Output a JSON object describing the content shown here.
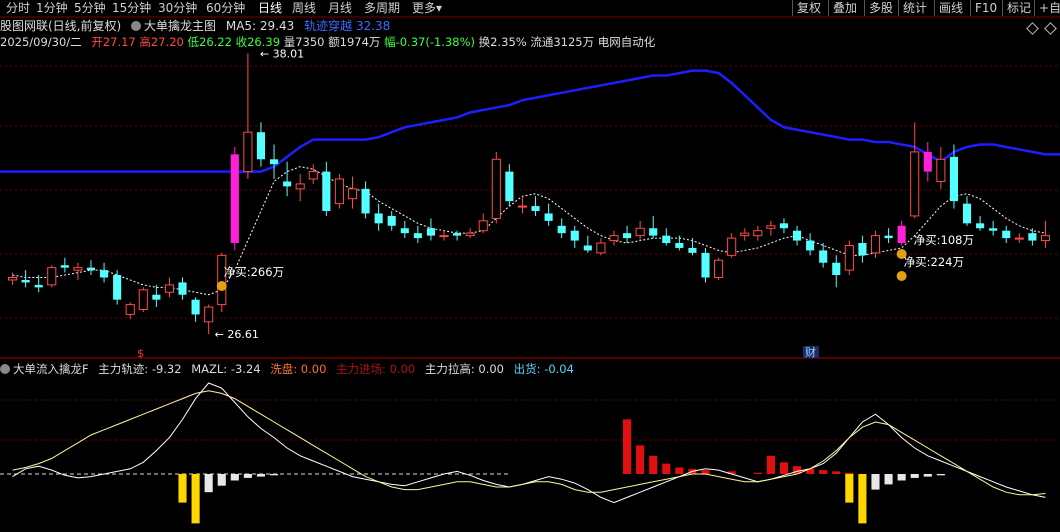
{
  "toolbar": {
    "periods": [
      "分时",
      "1分钟",
      "5分钟",
      "15分钟",
      "30分钟",
      "60分钟",
      "日线",
      "周线",
      "月线",
      "多周期",
      "更多"
    ],
    "active_period": "日线",
    "more_suffix": "▾",
    "right_buttons": [
      "复权",
      "叠加",
      "多股",
      "统计",
      "画线",
      "F10",
      "标记",
      "+自"
    ]
  },
  "header": {
    "stock_name": "股图网联(日线,前复权)",
    "indicator_name": "大单擒龙主图",
    "ma5_label": "MA5: 29.43",
    "ma_extra": "轨迹穿越",
    "ma_extra_value": "32.38"
  },
  "quote": {
    "date": "2025/09/30/二",
    "open_label": "开",
    "open": "27.17",
    "high_label": "高",
    "high": "27.20",
    "low_label": "低",
    "low": "26.22",
    "close_label": "收",
    "close": "26.39",
    "volume_label": "量",
    "volume": "7350",
    "amount_label": "额",
    "amount": "1974万",
    "change_label": "幅",
    "change": "-0.37(-1.38%)",
    "turnover_label": "换",
    "turnover": "2.35%",
    "float_label": "流通",
    "float": "3125万",
    "sector": "电网自动化"
  },
  "annotations": {
    "high_price": "38.01",
    "low_price": "26.61",
    "net_buy_1": "净买:266万",
    "net_buy_2": "净买:108万",
    "net_buy_3": "净买:224万",
    "finance_marker": "财",
    "dollar_marker": "$"
  },
  "indicator": {
    "name": "大单流入擒龙F",
    "track_label": "主力轨迹:",
    "track_value": "-9.32",
    "mazl_label": "MAZL:",
    "mazl_value": "-3.24",
    "wash_label": "洗盘:",
    "wash_value": "0.00",
    "enter_label": "主力进场:",
    "enter_value": "0.00",
    "lift_label": "主力拉高:",
    "lift_value": "0.00",
    "ship_label": "出货:",
    "ship_value": "-0.04"
  },
  "colors": {
    "up": "#ff4a4a",
    "down": "#54ffff",
    "ma_blue": "#1e1eff",
    "magenta": "#ff20d8",
    "grid": "#6a0000",
    "yellow": "#ffd700",
    "white_line": "#ffffff"
  },
  "chart_data": {
    "type": "candlestick",
    "price_range": [
      26.2,
      38.3
    ],
    "candles": [
      {
        "o": 28.8,
        "h": 29.1,
        "l": 28.6,
        "c": 28.9
      },
      {
        "o": 28.8,
        "h": 29.2,
        "l": 28.5,
        "c": 28.7
      },
      {
        "o": 28.6,
        "h": 29.0,
        "l": 28.3,
        "c": 28.5
      },
      {
        "o": 28.6,
        "h": 29.4,
        "l": 28.5,
        "c": 29.3
      },
      {
        "o": 29.4,
        "h": 29.7,
        "l": 29.1,
        "c": 29.3
      },
      {
        "o": 29.2,
        "h": 29.5,
        "l": 28.8,
        "c": 29.3
      },
      {
        "o": 29.3,
        "h": 29.6,
        "l": 29.0,
        "c": 29.2
      },
      {
        "o": 29.2,
        "h": 29.5,
        "l": 28.7,
        "c": 28.9
      },
      {
        "o": 29.0,
        "h": 29.2,
        "l": 27.8,
        "c": 28.0
      },
      {
        "o": 27.4,
        "h": 27.9,
        "l": 27.2,
        "c": 27.8
      },
      {
        "o": 27.6,
        "h": 28.5,
        "l": 27.5,
        "c": 28.4
      },
      {
        "o": 28.2,
        "h": 28.6,
        "l": 27.7,
        "c": 28.0
      },
      {
        "o": 28.3,
        "h": 28.9,
        "l": 28.1,
        "c": 28.6
      },
      {
        "o": 28.7,
        "h": 28.9,
        "l": 28.0,
        "c": 28.2
      },
      {
        "o": 28.0,
        "h": 28.1,
        "l": 27.1,
        "c": 27.4
      },
      {
        "o": 27.1,
        "h": 27.8,
        "l": 26.6,
        "c": 27.7
      },
      {
        "o": 27.8,
        "h": 29.9,
        "l": 27.5,
        "c": 29.8
      },
      {
        "o": 30.3,
        "h": 34.2,
        "l": 30.0,
        "c": 33.9
      },
      {
        "o": 33.2,
        "h": 38.0,
        "l": 32.9,
        "c": 34.8
      },
      {
        "o": 34.8,
        "h": 35.2,
        "l": 33.4,
        "c": 33.7
      },
      {
        "o": 33.7,
        "h": 34.3,
        "l": 32.9,
        "c": 33.5
      },
      {
        "o": 32.8,
        "h": 33.6,
        "l": 32.2,
        "c": 32.6
      },
      {
        "o": 32.5,
        "h": 33.1,
        "l": 32.0,
        "c": 32.7
      },
      {
        "o": 32.9,
        "h": 33.5,
        "l": 32.7,
        "c": 33.2
      },
      {
        "o": 33.2,
        "h": 33.6,
        "l": 31.4,
        "c": 31.6
      },
      {
        "o": 31.9,
        "h": 33.1,
        "l": 31.7,
        "c": 32.9
      },
      {
        "o": 32.1,
        "h": 33.0,
        "l": 31.7,
        "c": 32.5
      },
      {
        "o": 32.5,
        "h": 32.8,
        "l": 31.3,
        "c": 31.5
      },
      {
        "o": 31.5,
        "h": 31.9,
        "l": 30.8,
        "c": 31.1
      },
      {
        "o": 31.4,
        "h": 31.6,
        "l": 30.8,
        "c": 31.0
      },
      {
        "o": 30.9,
        "h": 31.2,
        "l": 30.5,
        "c": 30.7
      },
      {
        "o": 30.7,
        "h": 31.0,
        "l": 30.3,
        "c": 30.5
      },
      {
        "o": 30.9,
        "h": 31.3,
        "l": 30.4,
        "c": 30.6
      },
      {
        "o": 30.6,
        "h": 30.8,
        "l": 30.4,
        "c": 30.6
      },
      {
        "o": 30.7,
        "h": 30.8,
        "l": 30.4,
        "c": 30.6
      },
      {
        "o": 30.6,
        "h": 30.9,
        "l": 30.5,
        "c": 30.7
      },
      {
        "o": 30.8,
        "h": 31.5,
        "l": 30.7,
        "c": 31.2
      },
      {
        "o": 31.3,
        "h": 34.0,
        "l": 31.1,
        "c": 33.7
      },
      {
        "o": 33.2,
        "h": 33.5,
        "l": 31.8,
        "c": 32.0
      },
      {
        "o": 31.8,
        "h": 32.2,
        "l": 31.5,
        "c": 31.8
      },
      {
        "o": 31.8,
        "h": 32.2,
        "l": 31.4,
        "c": 31.6
      },
      {
        "o": 31.5,
        "h": 31.9,
        "l": 31.0,
        "c": 31.2
      },
      {
        "o": 31.0,
        "h": 31.3,
        "l": 30.5,
        "c": 30.7
      },
      {
        "o": 30.8,
        "h": 31.0,
        "l": 30.1,
        "c": 30.4
      },
      {
        "o": 30.2,
        "h": 30.6,
        "l": 29.9,
        "c": 30.0
      },
      {
        "o": 29.9,
        "h": 30.5,
        "l": 29.8,
        "c": 30.3
      },
      {
        "o": 30.4,
        "h": 30.8,
        "l": 30.2,
        "c": 30.6
      },
      {
        "o": 30.7,
        "h": 31.0,
        "l": 30.3,
        "c": 30.5
      },
      {
        "o": 30.6,
        "h": 31.2,
        "l": 30.4,
        "c": 30.9
      },
      {
        "o": 30.9,
        "h": 31.4,
        "l": 30.5,
        "c": 30.6
      },
      {
        "o": 30.6,
        "h": 30.9,
        "l": 30.2,
        "c": 30.3
      },
      {
        "o": 30.3,
        "h": 30.6,
        "l": 30.0,
        "c": 30.1
      },
      {
        "o": 30.1,
        "h": 30.5,
        "l": 29.8,
        "c": 29.9
      },
      {
        "o": 29.9,
        "h": 30.1,
        "l": 28.7,
        "c": 28.9
      },
      {
        "o": 28.9,
        "h": 29.7,
        "l": 28.8,
        "c": 29.6
      },
      {
        "o": 29.8,
        "h": 30.7,
        "l": 29.7,
        "c": 30.5
      },
      {
        "o": 30.6,
        "h": 30.9,
        "l": 30.4,
        "c": 30.7
      },
      {
        "o": 30.6,
        "h": 31.0,
        "l": 30.4,
        "c": 30.8
      },
      {
        "o": 30.9,
        "h": 31.2,
        "l": 30.6,
        "c": 31.0
      },
      {
        "o": 31.1,
        "h": 31.3,
        "l": 30.7,
        "c": 30.9
      },
      {
        "o": 30.8,
        "h": 31.0,
        "l": 30.2,
        "c": 30.4
      },
      {
        "o": 30.4,
        "h": 30.7,
        "l": 29.8,
        "c": 30.0
      },
      {
        "o": 30.0,
        "h": 30.3,
        "l": 29.3,
        "c": 29.5
      },
      {
        "o": 29.5,
        "h": 29.8,
        "l": 28.5,
        "c": 29.0
      },
      {
        "o": 29.2,
        "h": 30.4,
        "l": 29.0,
        "c": 30.2
      },
      {
        "o": 30.3,
        "h": 30.6,
        "l": 29.5,
        "c": 29.8
      },
      {
        "o": 29.9,
        "h": 30.8,
        "l": 29.7,
        "c": 30.6
      },
      {
        "o": 30.6,
        "h": 30.9,
        "l": 30.3,
        "c": 30.5
      },
      {
        "o": 30.3,
        "h": 31.2,
        "l": 30.2,
        "c": 31.0
      },
      {
        "o": 31.4,
        "h": 35.2,
        "l": 31.3,
        "c": 34.0
      },
      {
        "o": 34.0,
        "h": 34.4,
        "l": 32.8,
        "c": 33.2
      },
      {
        "o": 32.8,
        "h": 34.2,
        "l": 32.5,
        "c": 33.7
      },
      {
        "o": 33.8,
        "h": 34.3,
        "l": 31.7,
        "c": 32.0
      },
      {
        "o": 31.9,
        "h": 32.2,
        "l": 31.0,
        "c": 31.1
      },
      {
        "o": 31.1,
        "h": 31.4,
        "l": 30.8,
        "c": 30.9
      },
      {
        "o": 30.9,
        "h": 31.2,
        "l": 30.6,
        "c": 30.8
      },
      {
        "o": 30.8,
        "h": 31.0,
        "l": 30.3,
        "c": 30.5
      },
      {
        "o": 30.5,
        "h": 30.7,
        "l": 30.3,
        "c": 30.5
      },
      {
        "o": 30.7,
        "h": 30.9,
        "l": 30.2,
        "c": 30.4
      },
      {
        "o": 30.4,
        "h": 31.2,
        "l": 30.1,
        "c": 30.6
      }
    ],
    "ma_dotted": [
      29.0,
      28.9,
      28.9,
      28.9,
      29.0,
      29.1,
      29.2,
      29.2,
      29.0,
      28.8,
      28.6,
      28.5,
      28.5,
      28.4,
      28.3,
      28.2,
      28.4,
      29.2,
      30.4,
      31.6,
      32.8,
      33.2,
      33.4,
      33.3,
      33.0,
      32.7,
      32.5,
      32.4,
      32.0,
      31.7,
      31.4,
      31.1,
      30.9,
      30.8,
      30.7,
      30.7,
      30.8,
      31.3,
      31.8,
      32.2,
      32.3,
      32.1,
      31.7,
      31.3,
      30.9,
      30.6,
      30.4,
      30.3,
      30.4,
      30.5,
      30.5,
      30.5,
      30.4,
      30.2,
      30.0,
      29.9,
      30.0,
      30.1,
      30.3,
      30.5,
      30.6,
      30.4,
      30.2,
      30.0,
      29.8,
      29.8,
      29.9,
      30.0,
      30.1,
      30.6,
      31.2,
      31.8,
      32.2,
      32.3,
      32.1,
      31.7,
      31.3,
      31.0,
      30.8,
      30.7
    ],
    "ma_blue": [
      33.2,
      33.2,
      33.2,
      33.2,
      33.2,
      33.2,
      33.2,
      33.2,
      33.2,
      33.2,
      33.2,
      33.2,
      33.2,
      33.2,
      33.2,
      33.2,
      33.2,
      33.2,
      33.2,
      33.2,
      33.4,
      33.8,
      34.2,
      34.5,
      34.5,
      34.5,
      34.5,
      34.5,
      34.6,
      34.8,
      35.0,
      35.1,
      35.2,
      35.3,
      35.4,
      35.6,
      35.7,
      35.8,
      35.9,
      36.1,
      36.2,
      36.3,
      36.4,
      36.5,
      36.6,
      36.7,
      36.8,
      36.9,
      37.0,
      37.1,
      37.1,
      37.2,
      37.3,
      37.3,
      37.2,
      36.8,
      36.3,
      35.8,
      35.3,
      35.0,
      34.9,
      34.8,
      34.7,
      34.6,
      34.5,
      34.5,
      34.4,
      34.4,
      34.3,
      34.2,
      33.9,
      33.6,
      34.0,
      34.2,
      34.3,
      34.3,
      34.2,
      34.1,
      34.0,
      33.9
    ],
    "indicator_line_white": [
      -2,
      4,
      6,
      3,
      -1,
      -3,
      -2,
      0,
      2,
      4,
      9,
      18,
      28,
      42,
      58,
      70,
      66,
      55,
      44,
      35,
      28,
      20,
      14,
      10,
      6,
      2,
      -2,
      -4,
      -6,
      -8,
      -9,
      -6,
      -3,
      0,
      2,
      -1,
      -5,
      -8,
      -10,
      -8,
      -5,
      -2,
      -4,
      -7,
      -12,
      -18,
      -22,
      -18,
      -14,
      -10,
      -6,
      -2,
      2,
      4,
      3,
      0,
      -3,
      -6,
      -4,
      -1,
      2,
      4,
      8,
      16,
      28,
      40,
      46,
      38,
      28,
      20,
      14,
      10,
      6,
      2,
      -2,
      -6,
      -10,
      -13,
      -16,
      -18
    ],
    "indicator_line_yellow": [
      3,
      5,
      8,
      12,
      18,
      24,
      30,
      34,
      38,
      42,
      46,
      50,
      54,
      58,
      62,
      64,
      62,
      58,
      52,
      46,
      40,
      34,
      28,
      22,
      16,
      10,
      4,
      -2,
      -6,
      -10,
      -12,
      -12,
      -10,
      -8,
      -6,
      -6,
      -8,
      -10,
      -10,
      -8,
      -6,
      -6,
      -8,
      -12,
      -14,
      -14,
      -12,
      -10,
      -8,
      -6,
      -4,
      -2,
      0,
      0,
      -2,
      -4,
      -6,
      -6,
      -4,
      -2,
      0,
      4,
      10,
      18,
      28,
      36,
      40,
      38,
      32,
      26,
      20,
      14,
      8,
      2,
      -4,
      -10,
      -14,
      -16,
      -16,
      -15
    ],
    "bars_red": [
      {
        "i": 47,
        "v": 42
      },
      {
        "i": 48,
        "v": 22
      },
      {
        "i": 49,
        "v": 14
      },
      {
        "i": 50,
        "v": 8
      },
      {
        "i": 51,
        "v": 5
      },
      {
        "i": 52,
        "v": 4
      },
      {
        "i": 53,
        "v": 3
      },
      {
        "i": 55,
        "v": 2
      },
      {
        "i": 57,
        "v": 1
      },
      {
        "i": 58,
        "v": 14
      },
      {
        "i": 59,
        "v": 9
      },
      {
        "i": 60,
        "v": 6
      },
      {
        "i": 61,
        "v": 4
      },
      {
        "i": 62,
        "v": 3
      },
      {
        "i": 63,
        "v": 2
      },
      {
        "i": 64,
        "v": 1
      }
    ],
    "bars_yellow": [
      {
        "i": 13,
        "v": -22
      },
      {
        "i": 14,
        "v": -38
      },
      {
        "i": 64,
        "v": -22
      },
      {
        "i": 65,
        "v": -38
      }
    ],
    "bars_white": [
      {
        "i": 15,
        "v": -14
      },
      {
        "i": 16,
        "v": -9
      },
      {
        "i": 17,
        "v": -5
      },
      {
        "i": 18,
        "v": -3
      },
      {
        "i": 19,
        "v": -2
      },
      {
        "i": 20,
        "v": -1
      },
      {
        "i": 66,
        "v": -12
      },
      {
        "i": 67,
        "v": -8
      },
      {
        "i": 68,
        "v": -5
      },
      {
        "i": 69,
        "v": -3
      },
      {
        "i": 70,
        "v": -2
      },
      {
        "i": 71,
        "v": -1
      }
    ]
  }
}
